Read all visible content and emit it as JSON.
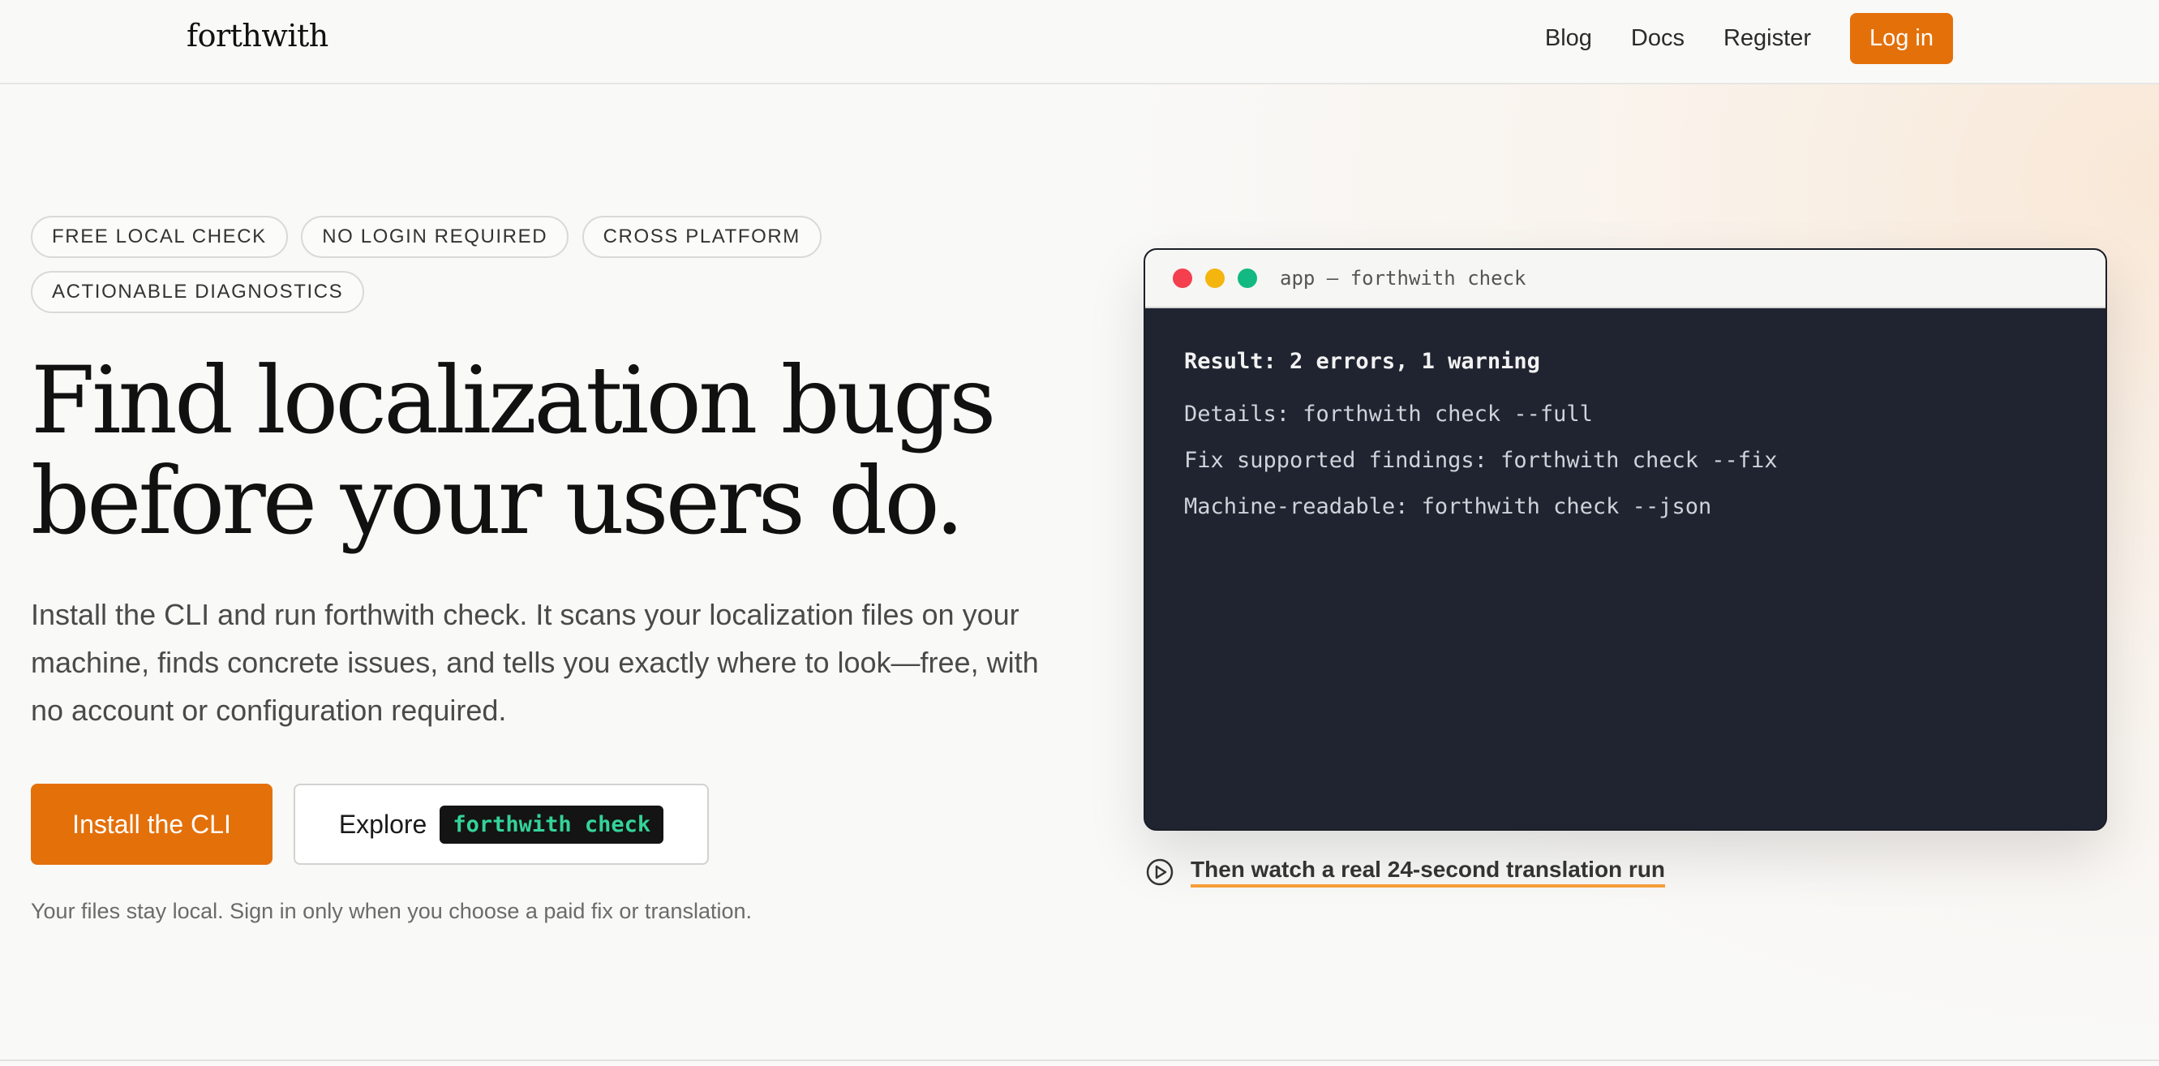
{
  "header": {
    "logo": "forthwith",
    "nav": [
      "Blog",
      "Docs",
      "Register"
    ],
    "login_label": "Log in",
    "accent_color": "#e4700a"
  },
  "hero": {
    "badges": [
      "FREE LOCAL CHECK",
      "NO LOGIN REQUIRED",
      "CROSS PLATFORM",
      "ACTIONABLE DIAGNOSTICS"
    ],
    "headline_line1": "Find localization bugs",
    "headline_line2": "before your users do.",
    "lead": "Install the CLI and run forthwith check. It scans your localization files on your machine, finds concrete issues, and tells you exactly where to look—free, with no account or configuration required.",
    "primary_cta": "Install the CLI",
    "secondary_cta_prefix": "Explore",
    "secondary_cta_code": "forthwith check",
    "fineprint": "Your files stay local. Sign in only when you choose a paid fix or translation."
  },
  "terminal": {
    "title": "app — forthwith check",
    "result": "Result: 2 errors, 1 warning",
    "lines": [
      "Details: forthwith check --full",
      "Fix supported findings: forthwith check --fix",
      "Machine-readable: forthwith check --json"
    ],
    "dot_colors": [
      "#f43f4e",
      "#f5b50f",
      "#12b981"
    ]
  },
  "watch_link": {
    "icon": "play-circle-icon",
    "label": "Then watch a real 24-second translation run"
  }
}
